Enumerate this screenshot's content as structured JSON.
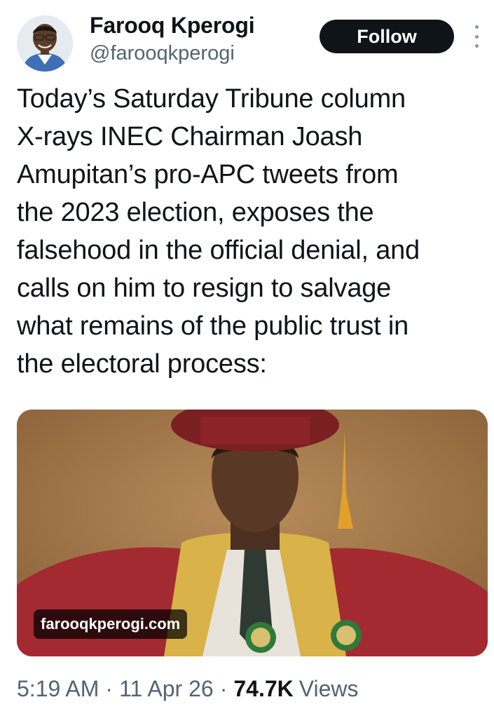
{
  "author": {
    "name": "Farooq Kperogi",
    "handle": "@farooqkperogi",
    "avatar_icon": "profile-photo-avatar"
  },
  "follow_label": "Follow",
  "more_icon": "more-options-icon",
  "tweet": {
    "text": "Today’s Saturday Tribune column\nX-rays INEC Chairman Joash\nAmupitan’s pro-APC tweets from\nthe 2023 election, exposes the\nfalsehood in the official denial, and\ncalls on him to resign to salvage\nwhat remains of the public trust in\nthe electoral process:"
  },
  "media": {
    "watermark": "farooqkperogi.com"
  },
  "meta": {
    "time": "5:19 AM",
    "separator": "·",
    "date": "11 Apr 26",
    "views_count": "74.7K",
    "views_label": "Views"
  },
  "colors": {
    "text_primary": "#0f1419",
    "text_secondary": "#536471",
    "follow_bg": "#0f1419",
    "follow_text": "#ffffff"
  }
}
